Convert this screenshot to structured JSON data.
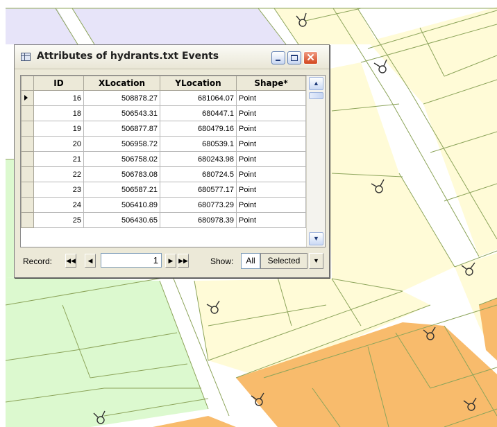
{
  "window": {
    "title": "Attributes of hydrants.txt Events",
    "close_glyph": "✕"
  },
  "table": {
    "columns": [
      "ID",
      "XLocation",
      "YLocation",
      "Shape*"
    ],
    "rows": [
      [
        "16",
        "508878.27",
        "681064.07",
        "Point"
      ],
      [
        "18",
        "506543.31",
        "680447.1",
        "Point"
      ],
      [
        "19",
        "506877.87",
        "680479.16",
        "Point"
      ],
      [
        "20",
        "506958.72",
        "680539.1",
        "Point"
      ],
      [
        "21",
        "506758.02",
        "680243.98",
        "Point"
      ],
      [
        "22",
        "506783.08",
        "680724.5",
        "Point"
      ],
      [
        "23",
        "506587.21",
        "680577.17",
        "Point"
      ],
      [
        "24",
        "506410.89",
        "680773.29",
        "Point"
      ],
      [
        "25",
        "506430.65",
        "680978.39",
        "Point"
      ]
    ]
  },
  "record_bar": {
    "label": "Record:",
    "current": "1",
    "show_label": "Show:",
    "all_label": "All",
    "selected_label": "Selected"
  },
  "icons": {
    "table_icon": "table-icon",
    "minimize": "minimize-icon",
    "maximize": "maximize-icon",
    "close": "close-icon",
    "first_record": "first-record-icon",
    "prev_record": "previous-record-icon",
    "next_record": "next-record-icon",
    "last_record": "last-record-icon",
    "scroll_up": "scroll-up-icon",
    "scroll_down": "scroll-down-icon",
    "dropdown": "dropdown-arrow-icon",
    "hydrant": "hydrant-symbol-icon"
  },
  "colors": {
    "map_background": "#ffffff",
    "parcel_lavender": "#e7e4f9",
    "parcel_pale_yellow": "#fffbd7",
    "parcel_orange": "#f8bb6c",
    "parcel_green": "#dcf9cf",
    "line_green": "#8ca45a",
    "window_face": "#ece9d8",
    "close_red": "#d2461d"
  }
}
